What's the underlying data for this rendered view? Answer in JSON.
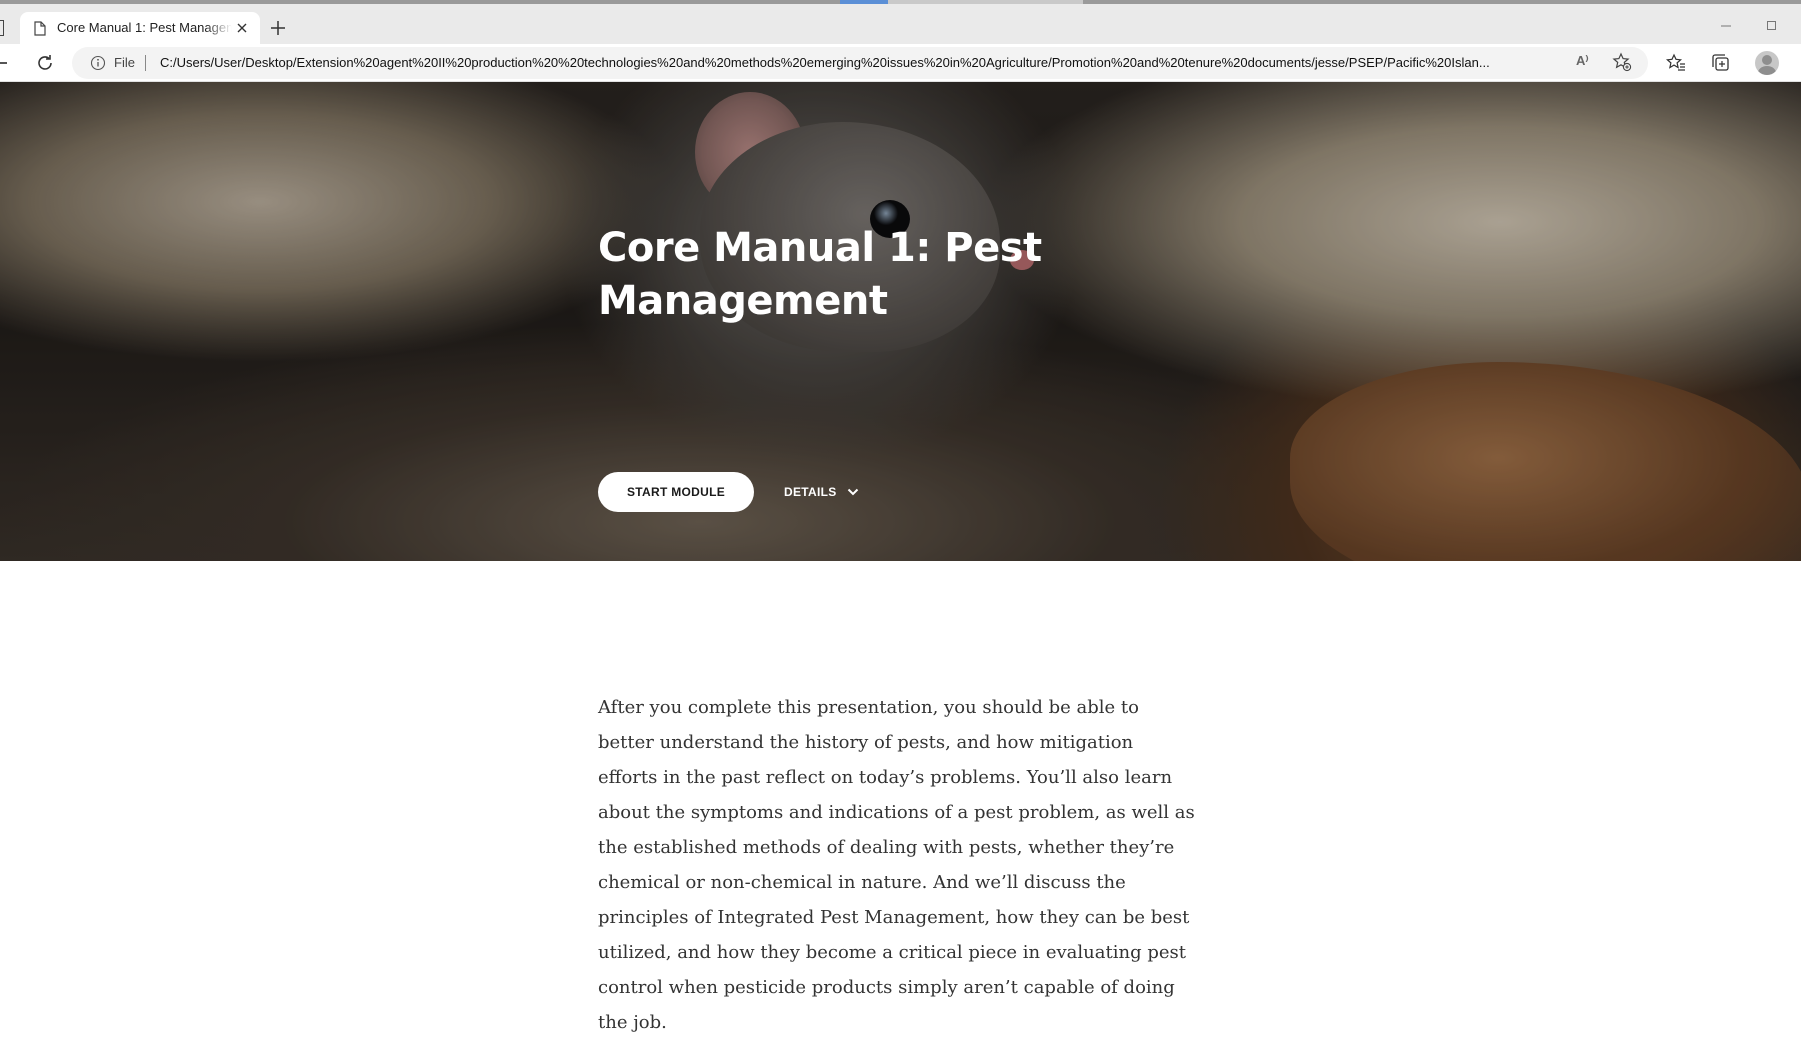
{
  "browser": {
    "tab_title": "Core Manual 1: Pest Management",
    "address_scheme_label": "File",
    "url": "C:/Users/User/Desktop/Extension%20agent%20II%20production%20%20technologies%20and%20methods%20emerging%20issues%20in%20Agriculture/Promotion%20and%20tenure%20documents/jesse/PSEP/Pacific%20Islan...",
    "read_aloud_glyph": "A⁾"
  },
  "hero": {
    "title": "Core Manual 1: Pest Management",
    "start_button": "START MODULE",
    "details_button": "DETAILS"
  },
  "description": "After you complete this presentation, you should be able to better understand the history of pests, and how mitigation efforts in the past reflect on today’s problems.  You’ll also learn about the symptoms and indications of a pest problem, as well as the established methods of dealing with pests, whether they’re chemical or non-chemical in nature.  And we’ll discuss the principles of Integrated Pest Management, how they can be best utilized, and how they become a critical piece in evaluating pest control when pesticide products simply aren’t capable of doing the job.",
  "colors": {
    "chrome_tabbar": "#eaeaea",
    "address_bar": "#f3f3f3",
    "button_bg": "#ffffff",
    "hero_text": "#ffffff",
    "body_text": "#333333"
  },
  "icons": [
    "page-icon",
    "close-icon",
    "plus-icon",
    "reload-icon",
    "info-icon",
    "read-aloud-icon",
    "add-favorite-icon",
    "favorites-icon",
    "collections-icon",
    "profile-avatar",
    "chevron-down-icon"
  ]
}
